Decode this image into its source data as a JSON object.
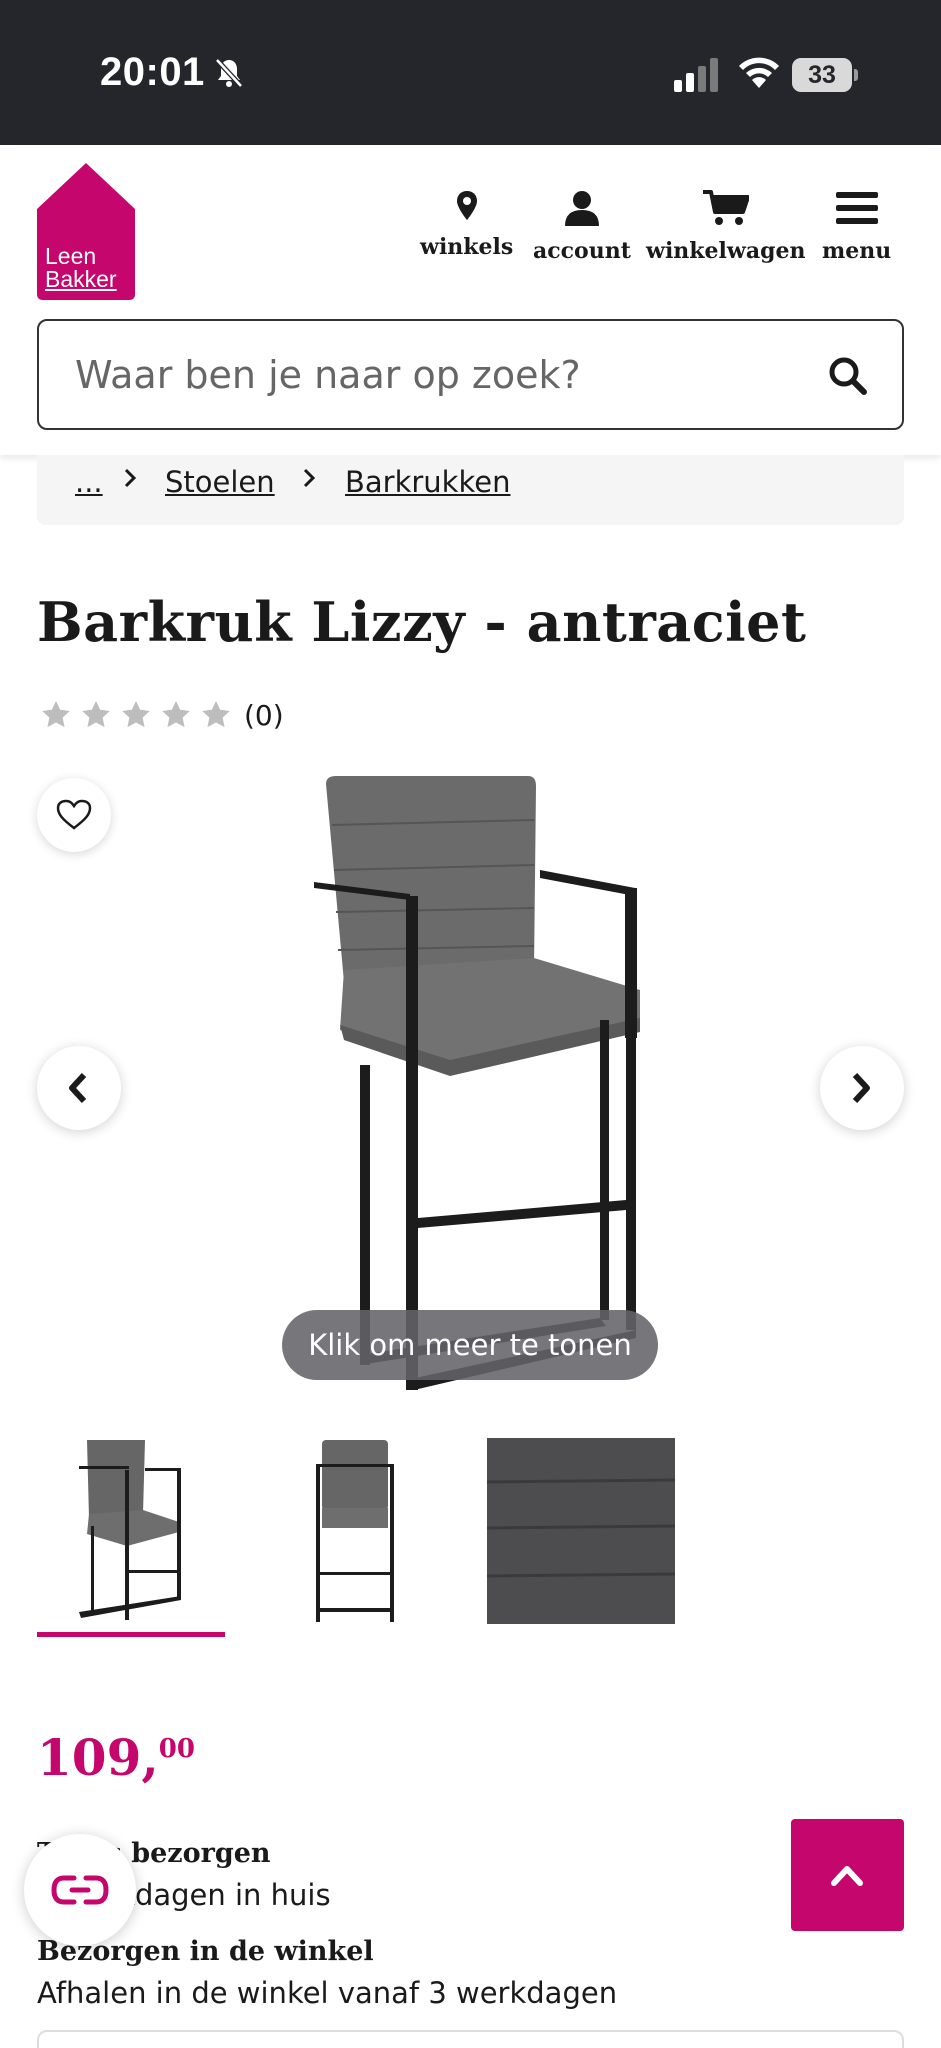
{
  "status_bar": {
    "time": "20:01",
    "battery": "33",
    "icons": [
      "bell-muted-icon",
      "signal-icon",
      "wifi-icon",
      "battery-icon"
    ]
  },
  "brand": {
    "logo_line1": "Leen",
    "logo_line2": "Bakker",
    "accent_color": "#c4066d"
  },
  "nav": {
    "items": [
      {
        "label": "winkels",
        "icon": "location-pin-icon"
      },
      {
        "label": "account",
        "icon": "user-icon"
      },
      {
        "label": "winkelwagen",
        "icon": "cart-icon"
      },
      {
        "label": "menu",
        "icon": "hamburger-icon"
      }
    ]
  },
  "search": {
    "placeholder": "Waar ben je naar op zoek?",
    "icon": "search-icon"
  },
  "breadcrumb": {
    "items": [
      "...",
      "Stoelen",
      "Barkrukken"
    ]
  },
  "product": {
    "title": "Barkruk Lizzy - antraciet",
    "rating_stars": 0,
    "rating_max": 5,
    "review_count": "(0)",
    "gallery_button": "Klik om meer te tonen",
    "thumbnails": [
      "chair-side-view",
      "chair-front-view",
      "fabric-detail"
    ],
    "price_int": "109,",
    "price_dec": "00"
  },
  "delivery": [
    {
      "heading": "Thuis bezorgen",
      "text": "3 werkdagen in huis"
    },
    {
      "heading": "Bezorgen in de winkel",
      "text": "Afhalen in de winkel vanaf 3 werkdagen"
    }
  ]
}
